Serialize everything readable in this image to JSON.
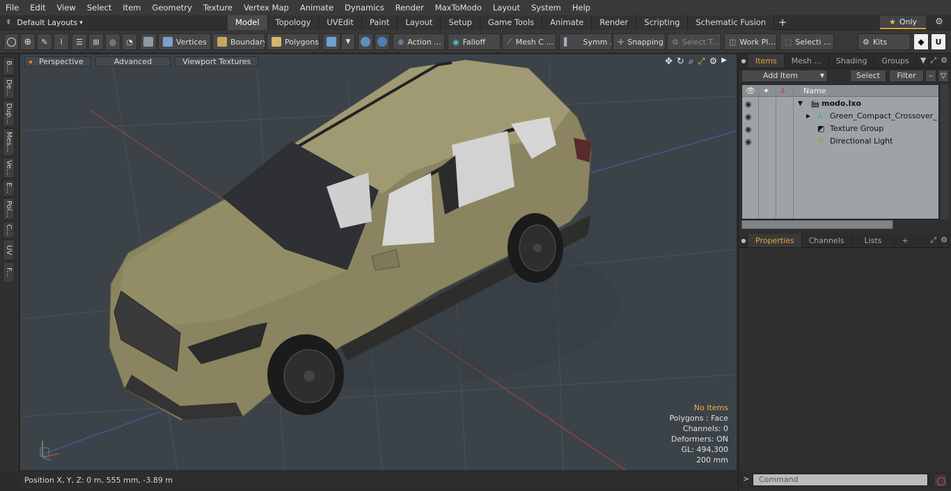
{
  "menu": [
    "File",
    "Edit",
    "View",
    "Select",
    "Item",
    "Geometry",
    "Texture",
    "Vertex Map",
    "Animate",
    "Dynamics",
    "Render",
    "MaxToModo",
    "Layout",
    "System",
    "Help"
  ],
  "layouts": {
    "label": "Default Layouts",
    "caret": "▾"
  },
  "tabs": [
    {
      "label": "Model",
      "active": true
    },
    {
      "label": "Topology"
    },
    {
      "label": "UVEdit"
    },
    {
      "label": "Paint"
    },
    {
      "label": "Layout"
    },
    {
      "label": "Setup"
    },
    {
      "label": "Game Tools"
    },
    {
      "label": "Animate"
    },
    {
      "label": "Render"
    },
    {
      "label": "Scripting"
    },
    {
      "label": "Schematic Fusion"
    }
  ],
  "tab_add": "+",
  "only": {
    "star": "★",
    "label": "Only"
  },
  "toolbar": {
    "vertices": "Vertices",
    "boundary": "Boundary",
    "polygons": "Polygons",
    "action": "Action ...",
    "falloff": "Falloff",
    "mesh_c": "Mesh C ...",
    "symm": "Symm ...",
    "snapping": "Snapping",
    "select_t": "Select T...",
    "work_pl": "Work Pl...",
    "selecti": "Selecti ...",
    "kits": "Kits"
  },
  "left_strip": [
    "B...",
    "De...",
    "Dup...",
    "Mes...",
    "Ve...",
    "E...",
    "Pol...",
    "C...",
    "UV",
    "F..."
  ],
  "viewport": {
    "perspective": "Perspective",
    "advanced": "Advanced",
    "textures": "Viewport Textures",
    "stats": {
      "no_items": "No Items",
      "polygons": "Polygons : Face",
      "channels": "Channels: 0",
      "deformers": "Deformers: ON",
      "gl": "GL: 494,300",
      "scale": "200 mm"
    }
  },
  "status": {
    "position": "Position X, Y, Z:   0 m, 555 mm, -3.89 m"
  },
  "items_panel": {
    "tabs": [
      {
        "label": "Items",
        "active": true
      },
      {
        "label": "Mesh ..."
      },
      {
        "label": "Shading"
      },
      {
        "label": "Groups"
      }
    ],
    "add_item": "Add Item",
    "select": "Select",
    "filter": "Filter",
    "col_name": "Name",
    "rows": [
      {
        "label": "modo.lxo",
        "bold": true
      },
      {
        "label": "Green_Compact_Crossover_ ..."
      },
      {
        "label": "Texture Group"
      },
      {
        "label": "Directional Light"
      }
    ]
  },
  "props_panel": {
    "tabs": [
      {
        "label": "Properties",
        "active": true
      },
      {
        "label": "Channels"
      },
      {
        "label": "Lists"
      }
    ],
    "add": "+"
  },
  "command": {
    "placeholder": "Command",
    "arrow": ">"
  },
  "colors": {
    "accent": "#e9a23b",
    "viewport_bg": "#3b4349",
    "car_body": "#8a8460"
  }
}
